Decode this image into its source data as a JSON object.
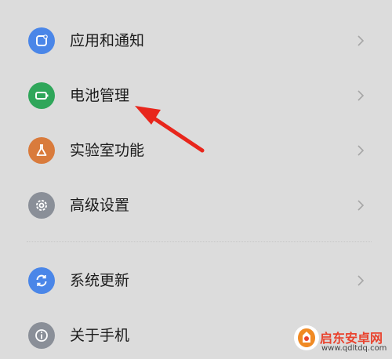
{
  "menu": {
    "items": [
      {
        "label": "应用和通知",
        "icon": "apps-notifications-icon",
        "icon_color": "#4a86e8"
      },
      {
        "label": "电池管理",
        "icon": "battery-icon",
        "icon_color": "#2fa65a"
      },
      {
        "label": "实验室功能",
        "icon": "flask-icon",
        "icon_color": "#d97b3c"
      },
      {
        "label": "高级设置",
        "icon": "gear-icon",
        "icon_color": "#8a8f98"
      },
      {
        "label": "系统更新",
        "icon": "update-icon",
        "icon_color": "#4a86e8"
      },
      {
        "label": "关于手机",
        "icon": "info-icon",
        "icon_color": "#8a8f98"
      }
    ]
  },
  "annotation": {
    "arrow_color": "#e8261c"
  },
  "watermark": {
    "title": "启东安卓网",
    "url": "www.qdltdq.com"
  }
}
